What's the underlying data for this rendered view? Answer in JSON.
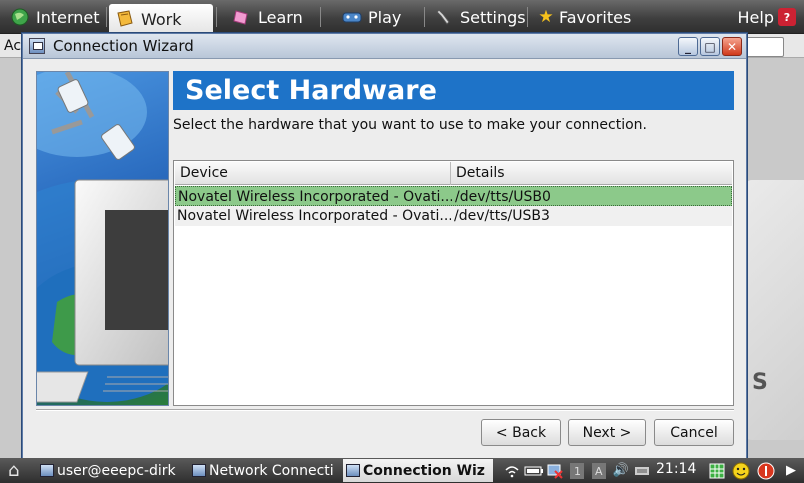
{
  "topbar": {
    "tabs": [
      {
        "label": "Internet",
        "icon": "globe-icon"
      },
      {
        "label": "Work",
        "icon": "folder-icon",
        "active": true
      },
      {
        "label": "Learn",
        "icon": "bookmark-icon"
      },
      {
        "label": "Play",
        "icon": "gamepad-icon"
      },
      {
        "label": "Settings",
        "icon": "wrench-icon"
      },
      {
        "label": "Favorites",
        "icon": "star-icon"
      }
    ],
    "help_label": "Help"
  },
  "background_app": {
    "strip_text": "Ac"
  },
  "dialog": {
    "title": "Connection Wizard",
    "header": "Select Hardware",
    "instructions": "Select the hardware that you want to use to make your connection.",
    "columns": [
      "Device",
      "Details"
    ],
    "rows": [
      {
        "device": "Novatel Wireless Incorporated - Ovati...",
        "details": "/dev/tts/USB0",
        "selected": true
      },
      {
        "device": "Novatel Wireless Incorporated - Ovati...",
        "details": "/dev/tts/USB3",
        "selected": false
      }
    ],
    "buttons": {
      "back": "< Back",
      "next": "Next >",
      "cancel": "Cancel"
    }
  },
  "taskbar": {
    "tasks": [
      {
        "label": "user@eeepc-dirk",
        "active": false
      },
      {
        "label": "Network Connecti",
        "active": false
      },
      {
        "label": "Connection Wiz",
        "active": true
      }
    ],
    "clock": "21:14"
  },
  "colors": {
    "header_blue": "#1e73c8",
    "selection_green": "#8cc98a",
    "taskbar": "#3a3a3a"
  }
}
